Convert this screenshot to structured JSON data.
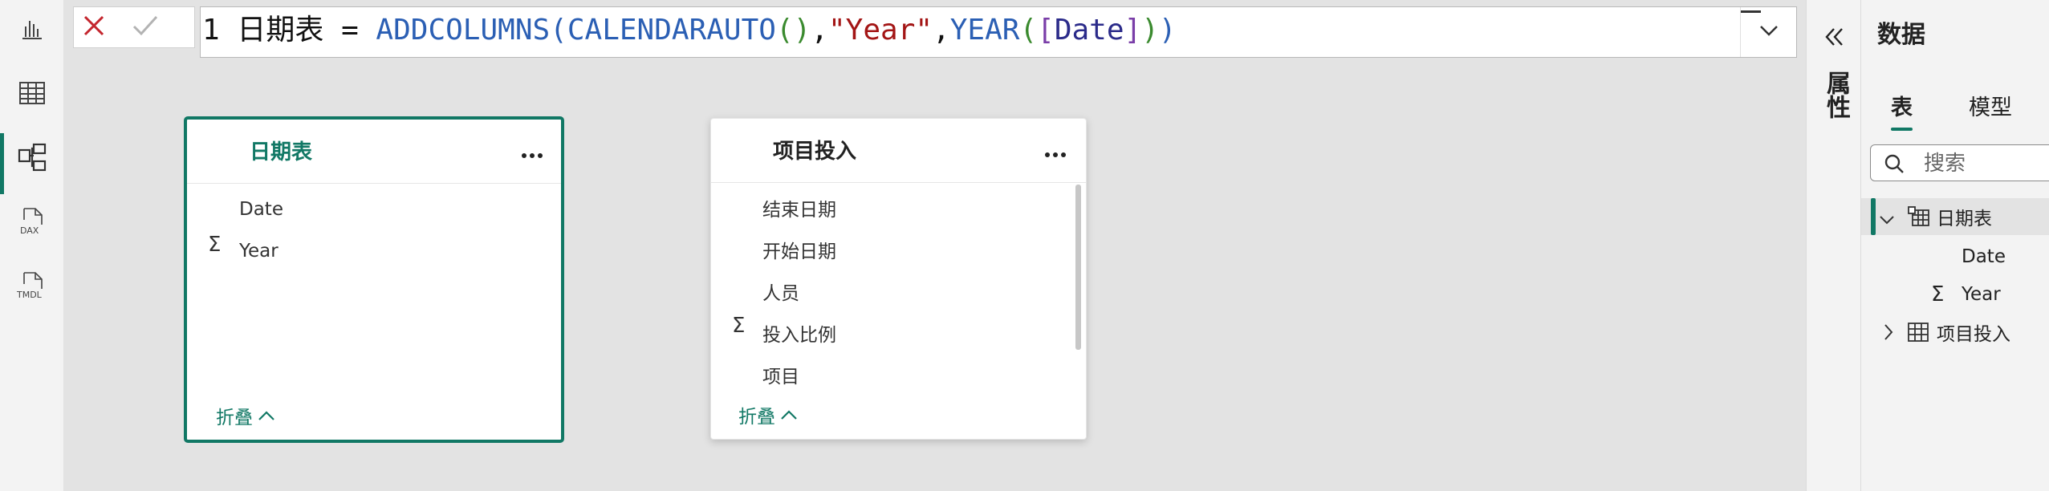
{
  "formula": {
    "line_number": "1",
    "table_name": "日期表",
    "equals": " = ",
    "fn_addcolumns": "ADDCOLUMNS",
    "fn_calendarauto": "CALENDARAUTO",
    "comma1": ",",
    "str_year": "\"Year\"",
    "comma2": ",",
    "fn_year": "YEAR",
    "field_date": "Date"
  },
  "cards": {
    "date_table": {
      "title": "日期表",
      "fields": [
        "Date",
        "Year"
      ],
      "collapse_label": "折叠"
    },
    "project_table": {
      "title": "项目投入",
      "fields": [
        "结束日期",
        "开始日期",
        "人员",
        "投入比例",
        "项目"
      ],
      "collapse_label": "折叠"
    }
  },
  "properties_pane": {
    "label": "属性"
  },
  "data_pane": {
    "title": "数据",
    "tabs": [
      "表",
      "模型"
    ],
    "search_placeholder": "搜索",
    "tree": {
      "table1": "日期表",
      "table1_fields": [
        "Date",
        "Year"
      ],
      "table2": "项目投入"
    }
  },
  "colors": {
    "accent": "#117865",
    "canvas": "#e3e3e3"
  }
}
